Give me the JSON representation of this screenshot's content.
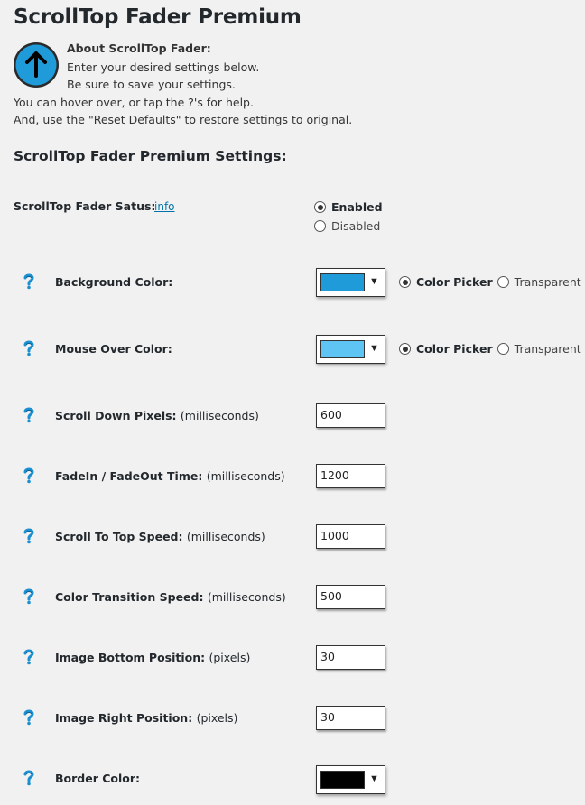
{
  "title": "ScrollTop Fader Premium",
  "about": {
    "heading": "About ScrollTop Fader:",
    "lines": [
      "Enter your desired settings below.",
      "Be sure to save your settings.",
      "You can hover over, or tap the ?'s for help.",
      "And, use the \"Reset Defaults\" to restore settings to original."
    ]
  },
  "settings_title": "ScrollTop Fader Premium Settings:",
  "status": {
    "label": "ScrollTop Fader Satus:",
    "info_link": "info",
    "options": [
      "Enabled",
      "Disabled"
    ],
    "selected": "Enabled"
  },
  "color_rows": [
    {
      "label": "Background Color:",
      "color": "#1f9bd9",
      "option_picker": "Color Picker",
      "option_transparent": "Transparent",
      "selected": "Color Picker"
    },
    {
      "label": "Mouse Over Color:",
      "color": "#5ec4f4",
      "option_picker": "Color Picker",
      "option_transparent": "Transparent",
      "selected": "Color Picker"
    }
  ],
  "input_rows": [
    {
      "label": "Scroll Down Pixels:",
      "unit": "(milliseconds)",
      "value": "600"
    },
    {
      "label": "FadeIn / FadeOut Time:",
      "unit": "(milliseconds)",
      "value": "1200"
    },
    {
      "label": "Scroll To Top Speed:",
      "unit": "(milliseconds)",
      "value": "1000"
    },
    {
      "label": "Color Transition Speed:",
      "unit": "(milliseconds)",
      "value": "500"
    },
    {
      "label": "Image Bottom Position:",
      "unit": "(pixels)",
      "value": "30"
    },
    {
      "label": "Image Right Position:",
      "unit": "(pixels)",
      "value": "30"
    }
  ],
  "border_row": {
    "label": "Border Color:",
    "color": "#000000"
  },
  "icons": {
    "logo": "arrow-up-circle-icon",
    "help": "question-mark-icon"
  },
  "colors": {
    "logo_blue": "#1f9bd9",
    "help_blue": "#1a8fd1",
    "link": "#0073aa",
    "background": "#f1f1f1"
  }
}
